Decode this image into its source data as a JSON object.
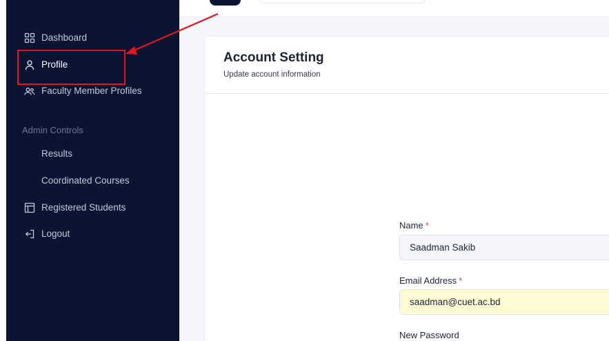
{
  "sidebar": {
    "items": [
      {
        "label": "Dashboard",
        "icon": "grid-icon"
      },
      {
        "label": "Profile",
        "icon": "user-icon"
      },
      {
        "label": "Faculty Member Profiles",
        "icon": "users-icon"
      },
      {
        "label": "Results",
        "icon": ""
      },
      {
        "label": "Coordinated Courses",
        "icon": ""
      },
      {
        "label": "Registered Students",
        "icon": "table-icon"
      },
      {
        "label": "Logout",
        "icon": "logout-icon"
      }
    ],
    "section_title": "Admin Controls"
  },
  "card": {
    "title": "Account Setting",
    "subtitle": "Update account information"
  },
  "form": {
    "name_label": "Name",
    "name_value": "Saadman Sakib",
    "email_label": "Email Address",
    "email_value": "saadman@cuet.ac.bd",
    "required_mark": "*",
    "password_label": "New Password"
  },
  "colors": {
    "sidebar_bg": "#0b1533",
    "annotation": "#e5161b",
    "autofill_bg": "#fdfbd3"
  }
}
